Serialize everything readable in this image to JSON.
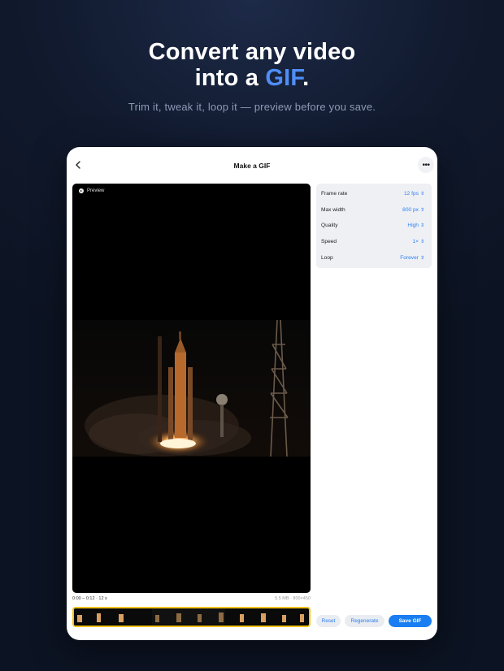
{
  "hero": {
    "title_line1": "Convert any video",
    "title_line2_prefix": "into a ",
    "title_line2_highlight": "GIF",
    "title_line2_suffix": ".",
    "subtitle": "Trim it, tweak it, loop it — preview before you save.",
    "highlight_color": "#4f8ef7"
  },
  "nav": {
    "title": "Make a GIF",
    "back_icon": "chevron-left-icon",
    "more_icon": "ellipsis-icon",
    "more_label": "•••"
  },
  "preview": {
    "label": "Preview",
    "icon": "play-icon"
  },
  "meta": {
    "range": "0:00 – 0:12 · 12 s",
    "info": "5.5 MB · 800×450"
  },
  "settings": [
    {
      "label": "Frame rate",
      "value": "12 fps"
    },
    {
      "label": "Max width",
      "value": "800 px"
    },
    {
      "label": "Quality",
      "value": "High"
    },
    {
      "label": "Speed",
      "value": "1×"
    },
    {
      "label": "Loop",
      "value": "Forever"
    }
  ],
  "actions": {
    "reset": "Reset",
    "regenerate": "Regenerate",
    "save": "Save GIF"
  },
  "colors": {
    "accent": "#1a7ef2",
    "filmstrip_border": "#f2c21b"
  }
}
